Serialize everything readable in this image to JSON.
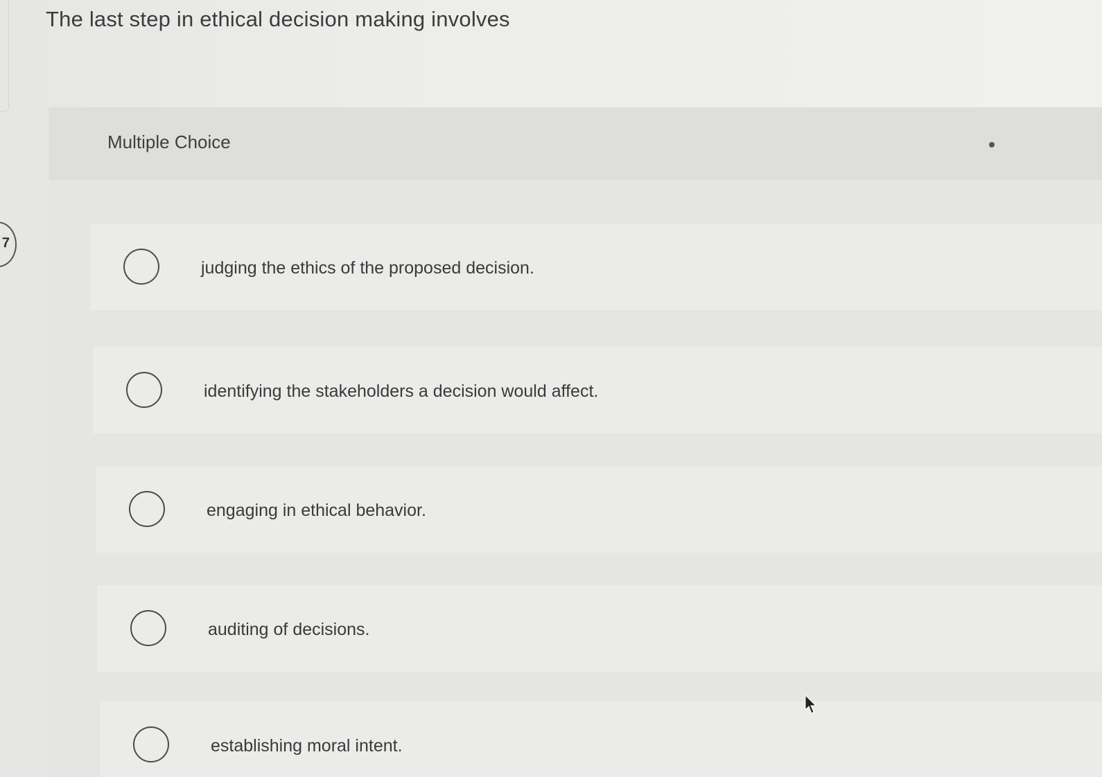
{
  "question": {
    "number": "7",
    "text": "The last step in ethical decision making involves"
  },
  "panel": {
    "header_label": "Multiple Choice"
  },
  "choices": [
    {
      "label": "judging the ethics of the proposed decision."
    },
    {
      "label": "identifying the stakeholders a decision would affect."
    },
    {
      "label": "engaging in ethical behavior."
    },
    {
      "label": "auditing of decisions."
    },
    {
      "label": "establishing moral intent."
    }
  ],
  "colors": {
    "background": "#ececea",
    "panel": "#e5e5e3",
    "text": "#3a3a3a"
  }
}
